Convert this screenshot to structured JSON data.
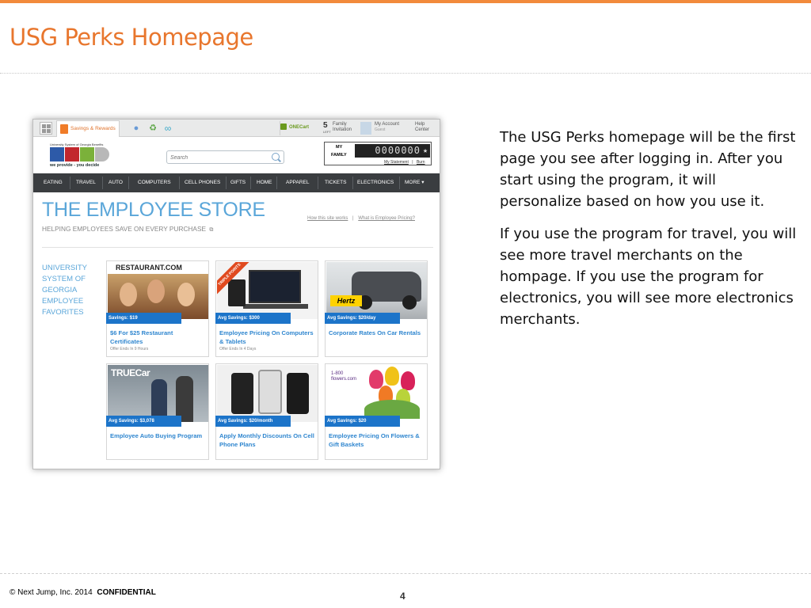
{
  "slide": {
    "title": "USG Perks Homepage",
    "paragraphs": [
      "The USG Perks homepage will be the first page you see after logging in. After you start using the program, it will personalize based on how you use it.",
      "If you use the program for travel, you will see more travel merchants on the hompage. If you use the program for electronics, you will see more electronics merchants."
    ],
    "footer_copyright": "© Next Jump, Inc. 2014",
    "footer_confidential": "CONFIDENTIAL",
    "page_number": "4",
    "accent_color": "#e8762d"
  },
  "site": {
    "tabs": {
      "active_label": "Savings & Rewards",
      "onecart_label": "ONECart",
      "family_count": "5",
      "family_left": "LEFT",
      "family_label_1": "Family",
      "family_label_2": "Invitation",
      "account_label": "My Account",
      "account_sub": "Guest",
      "help_label_1": "Help",
      "help_label_2": "Center"
    },
    "logo_small": "University System of Georgia Benefits",
    "logo_tagline": "we provide - you decide",
    "search_placeholder": "Search",
    "my_family": {
      "my_label": "MY",
      "family_label": "FAMILY",
      "counter": "0000000",
      "statement_link": "My Statement",
      "burn_link": "Burn",
      "separator": "|"
    },
    "nav": [
      "EATING",
      "TRAVEL",
      "AUTO",
      "COMPUTERS",
      "CELL PHONES",
      "GIFTS",
      "HOME",
      "APPAREL",
      "TICKETS",
      "ELECTRONICS",
      "MORE ▾"
    ],
    "store_title": "THE EMPLOYEE STORE",
    "store_subtitle": "HELPING EMPLOYEES SAVE ON EVERY PURCHASE",
    "store_links": [
      "How this site works",
      "What is Employee Pricing?"
    ],
    "store_links_separator": "|",
    "favorites": [
      "UNIVERSITY",
      "SYSTEM OF",
      "GEORGIA",
      "EMPLOYEE",
      "FAVORITES"
    ],
    "cards": [
      {
        "brand": "RESTAURANT.COM",
        "savings": "Savings: $19",
        "desc": "$6 For $25 Restaurant Certificates",
        "offer": "Offer Ends In 9 Hours"
      },
      {
        "brand": "TRIPLE POINTS",
        "savings": "Avg Savings: $300",
        "desc": "Employee Pricing On Computers & Tablets",
        "offer": "Offer Ends In 4 Days"
      },
      {
        "brand": "Hertz",
        "savings": "Avg Savings: $20/day",
        "desc": "Corporate Rates On Car Rentals",
        "offer": ""
      },
      {
        "brand": "TRUECar",
        "savings": "Avg Savings: $3,078",
        "desc": "Employee Auto Buying Program",
        "offer": ""
      },
      {
        "brand": "",
        "savings": "Avg Savings: $20/month",
        "desc": "Apply Monthly Discounts On Cell Phone Plans",
        "offer": ""
      },
      {
        "brand": "1-800 flowers.com",
        "savings": "Avg Savings: $20",
        "desc": "Employee Pricing On Flowers & Gift Baskets",
        "offer": ""
      }
    ]
  }
}
